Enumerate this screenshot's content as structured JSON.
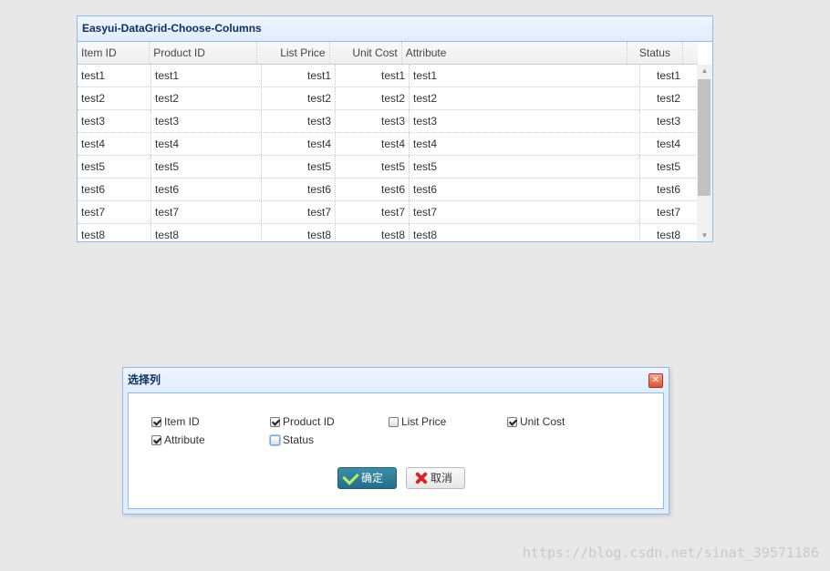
{
  "grid": {
    "title": "Easyui-DataGrid-Choose-Columns",
    "columns": [
      "Item ID",
      "Product ID",
      "List Price",
      "Unit Cost",
      "Attribute",
      "Status"
    ],
    "rows": [
      [
        "test1",
        "test1",
        "test1",
        "test1",
        "test1",
        "test1"
      ],
      [
        "test2",
        "test2",
        "test2",
        "test2",
        "test2",
        "test2"
      ],
      [
        "test3",
        "test3",
        "test3",
        "test3",
        "test3",
        "test3"
      ],
      [
        "test4",
        "test4",
        "test4",
        "test4",
        "test4",
        "test4"
      ],
      [
        "test5",
        "test5",
        "test5",
        "test5",
        "test5",
        "test5"
      ],
      [
        "test6",
        "test6",
        "test6",
        "test6",
        "test6",
        "test6"
      ],
      [
        "test7",
        "test7",
        "test7",
        "test7",
        "test7",
        "test7"
      ],
      [
        "test8",
        "test8",
        "test8",
        "test8",
        "test8",
        "test8"
      ]
    ]
  },
  "dialog": {
    "title": "选择列",
    "options": [
      {
        "label": "Item ID",
        "checked": true
      },
      {
        "label": "Product ID",
        "checked": true
      },
      {
        "label": "List Price",
        "checked": false
      },
      {
        "label": "Unit Cost",
        "checked": true
      },
      {
        "label": "Attribute",
        "checked": true
      },
      {
        "label": "Status",
        "checked": false
      }
    ],
    "ok_label": "确定",
    "cancel_label": "取消"
  },
  "watermark": "https://blog.csdn.net/sinat_39571186"
}
